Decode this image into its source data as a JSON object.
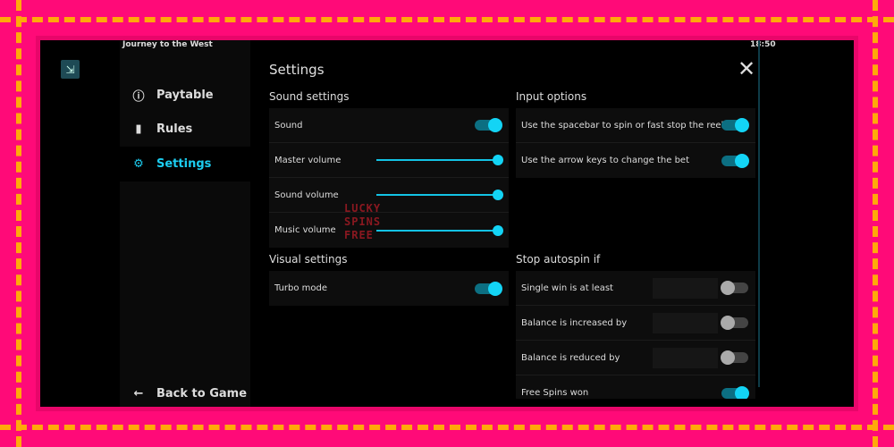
{
  "game_title": "Journey to the West",
  "clock": "18:50",
  "sidebar": {
    "items": [
      {
        "label": "Paytable",
        "icon": "info-icon"
      },
      {
        "label": "Rules",
        "icon": "book-icon"
      },
      {
        "label": "Settings",
        "icon": "gear-icon",
        "active": true
      }
    ],
    "back": "Back to Game"
  },
  "page_title": "Settings",
  "sound": {
    "title": "Sound settings",
    "sound": "Sound",
    "sound_on": true,
    "master": "Master volume",
    "master_value": 100,
    "sfx": "Sound volume",
    "sfx_value": 100,
    "music": "Music volume",
    "music_value": 100
  },
  "visual": {
    "title": "Visual settings",
    "turbo": "Turbo mode",
    "turbo_on": true
  },
  "input": {
    "title": "Input options",
    "spacebar": "Use the spacebar to spin or fast stop the reels",
    "spacebar_on": true,
    "arrows": "Use the arrow keys to change the bet",
    "arrows_on": true
  },
  "autospin": {
    "title": "Stop autospin if",
    "items": [
      {
        "label": "Single win is at least",
        "value": "",
        "on": false
      },
      {
        "label": "Balance is increased by",
        "value": "",
        "on": false
      },
      {
        "label": "Balance is reduced by",
        "value": "",
        "on": false
      },
      {
        "label": "Free Spins won",
        "on": true
      }
    ]
  },
  "watermark": "LUCKY SPINS FREE",
  "colors": {
    "accent": "#13d4f5",
    "border": "#ff0a78",
    "dash": "#ffa90a"
  }
}
